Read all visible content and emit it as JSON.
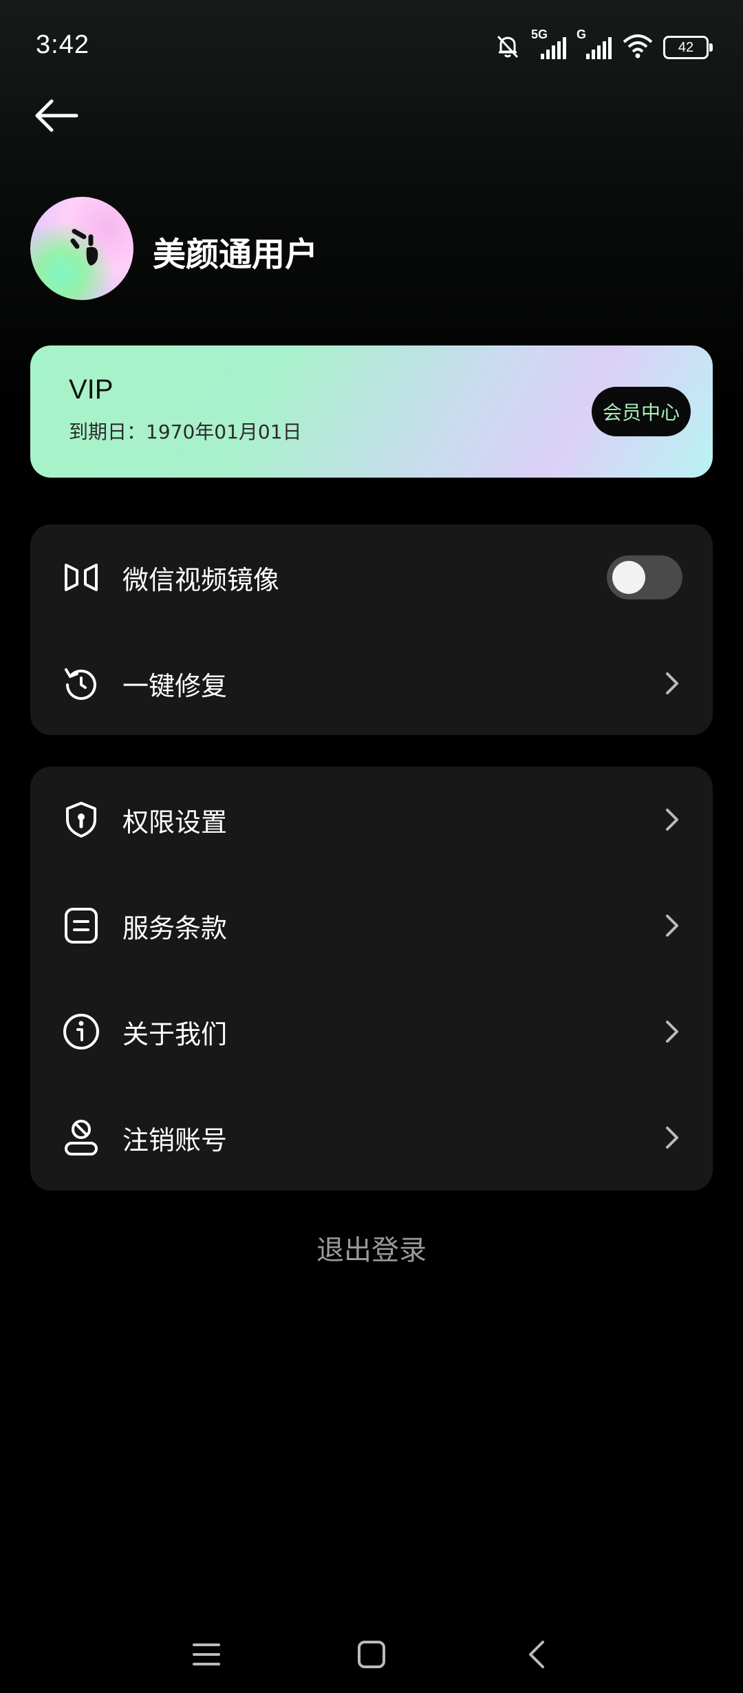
{
  "status_bar": {
    "time": "3:42",
    "network_1": "5G",
    "network_2": "G",
    "battery_level": "42"
  },
  "profile": {
    "username": "美颜通用户"
  },
  "vip": {
    "title": "VIP",
    "expiry": "到期日：1970年01月01日",
    "member_center_label": "会员中心",
    "gradient_colors": [
      "#a7f3c9",
      "#dcd0f7",
      "#b8f3f3"
    ]
  },
  "group_1": {
    "items": [
      {
        "label": "微信视频镜像",
        "icon": "mirror-icon",
        "control": "toggle",
        "toggle_on": false
      },
      {
        "label": "一键修复",
        "icon": "refresh-icon",
        "control": "chevron"
      }
    ]
  },
  "group_2": {
    "items": [
      {
        "label": "权限设置",
        "icon": "shield-icon",
        "control": "chevron"
      },
      {
        "label": "服务条款",
        "icon": "document-icon",
        "control": "chevron"
      },
      {
        "label": "关于我们",
        "icon": "info-icon",
        "control": "chevron"
      },
      {
        "label": "注销账号",
        "icon": "user-cancel-icon",
        "control": "chevron"
      }
    ]
  },
  "logout": {
    "label": "退出登录"
  },
  "colors": {
    "background": "#000000",
    "card": "#181818",
    "accent_green": "#a8f0b8",
    "muted_text": "#9a9a9a"
  }
}
